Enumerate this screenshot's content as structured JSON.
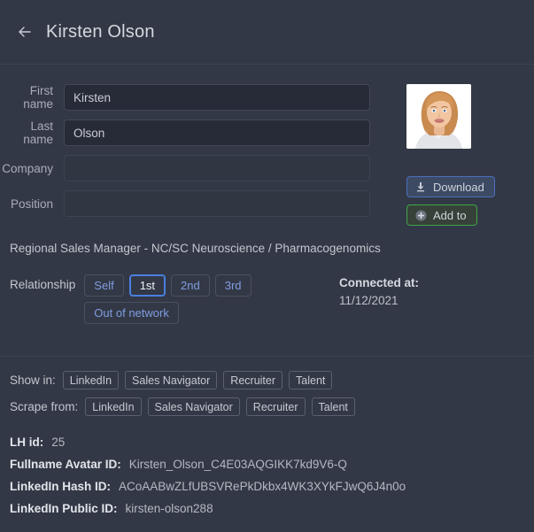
{
  "header": {
    "back_icon": "arrow-left-icon",
    "title": "Kirsten Olson"
  },
  "form": {
    "fields": [
      {
        "label": "First name",
        "value": "Kirsten",
        "placeholder": "",
        "filled": true
      },
      {
        "label": "Last name",
        "value": "Olson",
        "placeholder": "",
        "filled": true
      },
      {
        "label": "Company",
        "value": "",
        "placeholder": "",
        "filled": false
      },
      {
        "label": "Position",
        "value": "",
        "placeholder": "",
        "filled": false
      }
    ]
  },
  "avatar": {
    "name": "profile-photo",
    "alt": "Kirsten Olson"
  },
  "actions": {
    "download_label": "Download",
    "download_icon": "download-icon",
    "download_border_color": "#4a6fbd",
    "add_to_label": "Add to",
    "add_to_icon": "plus-circle-icon",
    "add_to_border_color": "#3fa64a"
  },
  "headline": "Regional Sales Manager - NC/SC Neuroscience / Pharmacogenomics",
  "relationship": {
    "label": "Relationship",
    "options": [
      {
        "label": "Self",
        "selected": false
      },
      {
        "label": "1st",
        "selected": true
      },
      {
        "label": "2nd",
        "selected": false
      },
      {
        "label": "3rd",
        "selected": false
      },
      {
        "label": "Out of network",
        "selected": false
      }
    ],
    "selected_color": "#4a7fe0"
  },
  "connected": {
    "label": "Connected at:",
    "date": "11/12/2021"
  },
  "show_in": {
    "label": "Show in:",
    "options": [
      "LinkedIn",
      "Sales Navigator",
      "Recruiter",
      "Talent"
    ]
  },
  "scrape_from": {
    "label": "Scrape from:",
    "options": [
      "LinkedIn",
      "Sales Navigator",
      "Recruiter",
      "Talent"
    ]
  },
  "meta": [
    {
      "key": "LH id:",
      "value": "25"
    },
    {
      "key": "Fullname Avatar ID:",
      "value": "Kirsten_Olson_C4E03AQGIKK7kd9V6-Q"
    },
    {
      "key": "LinkedIn Hash ID:",
      "value": "ACoAABwZLfUBSVRePkDkbx4WK3XYkFJwQ6J4n0o"
    },
    {
      "key": "LinkedIn Public ID:",
      "value": "kirsten-olson288"
    }
  ]
}
